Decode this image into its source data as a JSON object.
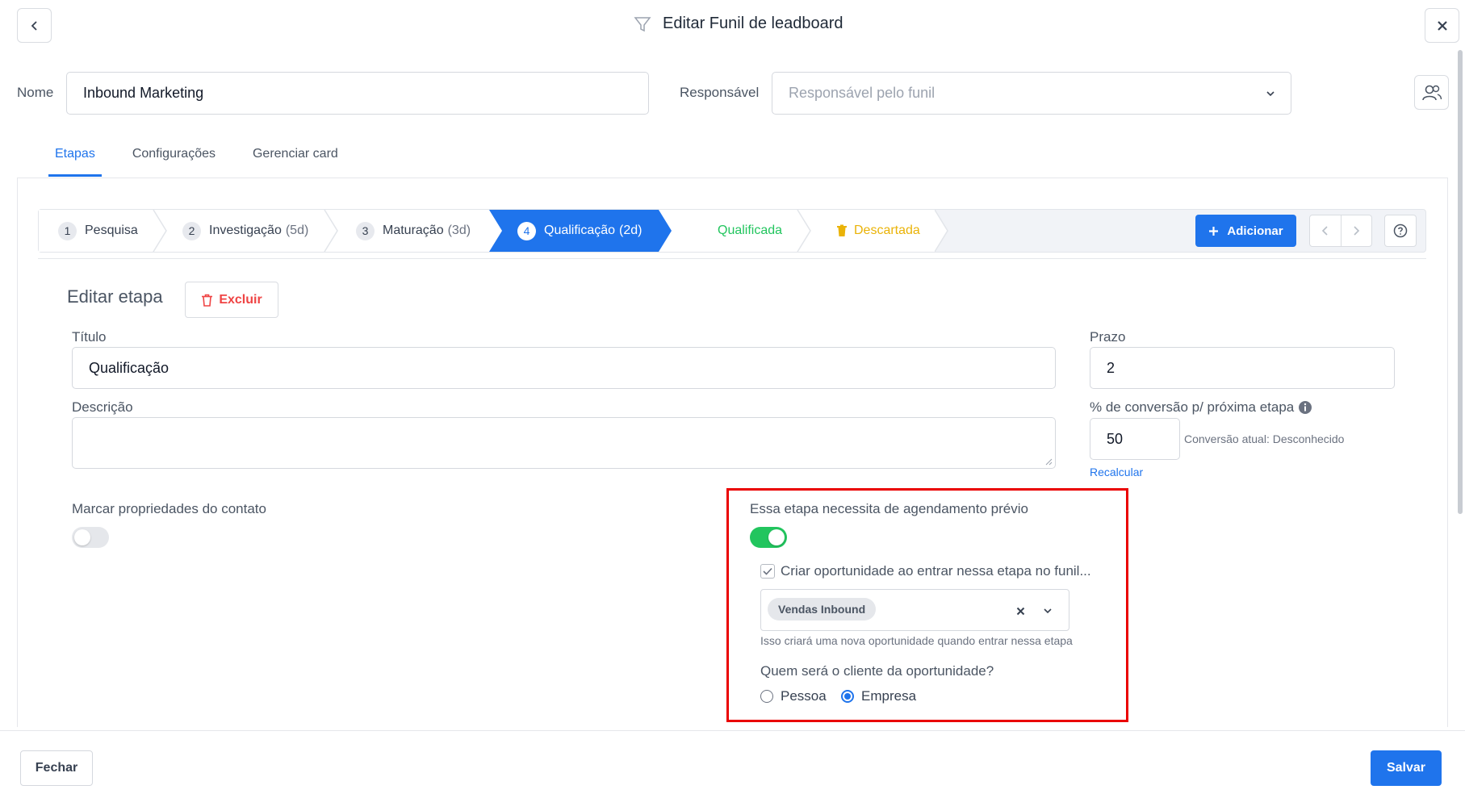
{
  "header": {
    "title": "Editar Funil de leadboard"
  },
  "form": {
    "name_label": "Nome",
    "name_value": "Inbound Marketing",
    "responsible_label": "Responsável",
    "responsible_placeholder": "Responsável pelo funil"
  },
  "tabs": [
    {
      "label": "Etapas",
      "active": true
    },
    {
      "label": "Configurações",
      "active": false
    },
    {
      "label": "Gerenciar card",
      "active": false
    }
  ],
  "steps": [
    {
      "number": "1",
      "label": "Pesquisa",
      "duration": ""
    },
    {
      "number": "2",
      "label": "Investigação",
      "duration": "(5d)"
    },
    {
      "number": "3",
      "label": "Maturação",
      "duration": "(3d)"
    },
    {
      "number": "4",
      "label": "Qualificação",
      "duration": "(2d)"
    }
  ],
  "final_steps": {
    "qualified": "Qualificada",
    "discarded": "Descartada"
  },
  "toolbar": {
    "add_label": "Adicionar"
  },
  "edit": {
    "section_title": "Editar etapa",
    "delete_label": "Excluir",
    "title_label": "Título",
    "title_value": "Qualificação",
    "deadline_label": "Prazo",
    "deadline_value": "2",
    "description_label": "Descrição",
    "description_value": "",
    "conversion_label": "% de conversão p/ próxima etapa",
    "conversion_value": "50",
    "conversion_current": "Conversão atual: Desconhecido",
    "recalc_label": "Recalcular",
    "mark_props_label": "Marcar propriedades do contato",
    "mark_props_on": false
  },
  "scheduling": {
    "label": "Essa etapa necessita de agendamento prévio",
    "enabled": true,
    "create_opportunity_label": "Criar oportunidade ao entrar nessa etapa no funil...",
    "create_opportunity_checked": true,
    "selected_funnel": "Vendas Inbound",
    "helper_text": "Isso criará uma nova oportunidade quando entrar nessa etapa",
    "client_question": "Quem será o cliente da oportunidade?",
    "options": [
      {
        "label": "Pessoa",
        "selected": false
      },
      {
        "label": "Empresa",
        "selected": true
      }
    ]
  },
  "footer": {
    "close_label": "Fechar",
    "save_label": "Salvar"
  },
  "colors": {
    "accent": "#1f74ec",
    "success": "#22c55e",
    "danger": "#ef4444",
    "warning": "#eab308",
    "highlight_border": "#ea0000"
  }
}
